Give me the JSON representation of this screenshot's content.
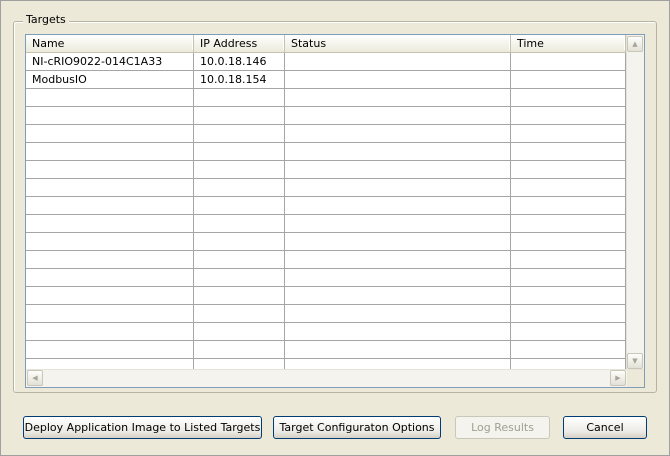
{
  "group": {
    "label": "Targets"
  },
  "table": {
    "columns": [
      "Name",
      "IP Address",
      "Status",
      "Time"
    ],
    "rows": [
      {
        "name": "NI-cRIO9022-014C1A33",
        "ip": "10.0.18.146",
        "status": "",
        "time": ""
      },
      {
        "name": "ModbusIO",
        "ip": "10.0.18.154",
        "status": "",
        "time": ""
      }
    ]
  },
  "scroll_glyphs": {
    "up": "▲",
    "down": "▼",
    "left": "◀",
    "right": "▶"
  },
  "buttons": {
    "deploy": "Deploy Application Image to Listed Targets",
    "config": "Target Configuraton Options",
    "log": "Log Results",
    "cancel": "Cancel"
  }
}
